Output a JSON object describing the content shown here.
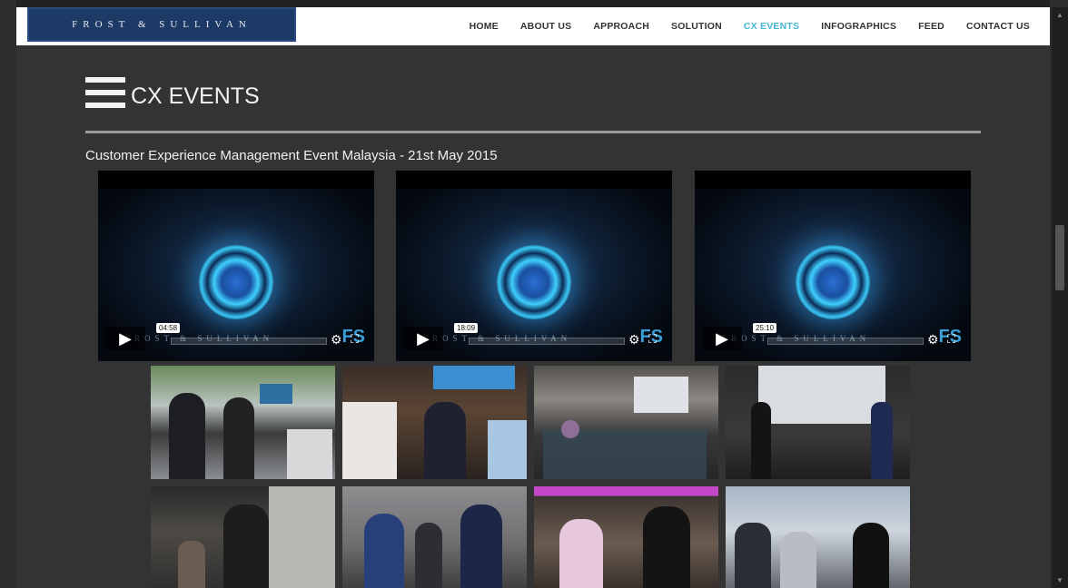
{
  "header": {
    "logo_text": "FROST & SULLIVAN",
    "nav": [
      {
        "label": "HOME",
        "active": false
      },
      {
        "label": "ABOUT US",
        "active": false
      },
      {
        "label": "APPROACH",
        "active": false
      },
      {
        "label": "SOLUTION",
        "active": false
      },
      {
        "label": "CX EVENTS",
        "active": true
      },
      {
        "label": "INFOGRAPHICS",
        "active": false
      },
      {
        "label": "FEED",
        "active": false
      },
      {
        "label": "CONTACT US",
        "active": false
      }
    ]
  },
  "section": {
    "title": "CX EVENTS",
    "event_title": "Customer Experience Management Event Malaysia - 21st May 2015"
  },
  "videos": [
    {
      "duration": "04:58",
      "brand": "FROST & SULLIVAN",
      "badge": "FS"
    },
    {
      "duration": "18:09",
      "brand": "FROST & SULLIVAN",
      "badge": "FS"
    },
    {
      "duration": "25:10",
      "brand": "FROST & SULLIVAN",
      "badge": "FS"
    }
  ],
  "gallery_count": 8,
  "colors": {
    "accent": "#46b5d6",
    "logo_bg": "#1d3a66",
    "page_bg": "#333333"
  },
  "icons": {
    "menu": "hamburger-icon",
    "play": "play-icon",
    "settings": "gear-icon",
    "fullscreen": "fullscreen-icon"
  }
}
